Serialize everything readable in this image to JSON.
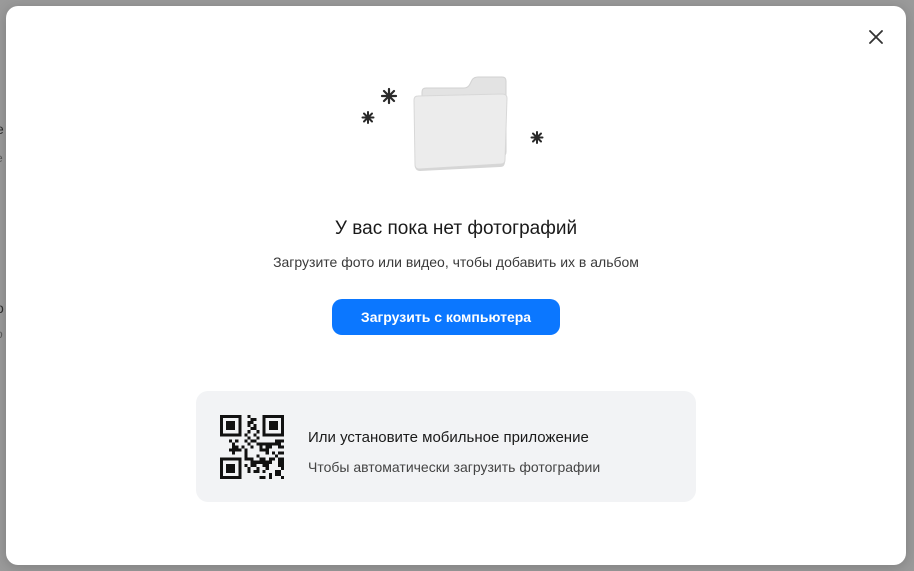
{
  "background_page": {
    "fragments": [
      "е",
      "е",
      "о",
      "о"
    ]
  },
  "modal": {
    "close_icon": "close-icon",
    "empty_state": {
      "illustration_icon": "empty-folder-icon",
      "title": "У вас пока нет фотографий",
      "subtitle": "Загрузите фото или видео, чтобы добавить их в альбом",
      "upload_button_label": "Загрузить с компьютера"
    },
    "mobile_app": {
      "qr_icon": "qr-code-icon",
      "title": "Или установите мобильное приложение",
      "subtitle": "Чтобы автоматически загрузить фотографии"
    }
  },
  "colors": {
    "accent": "#0b77ff",
    "card_background": "#f2f3f5",
    "overlay": "#8c8c8c"
  }
}
